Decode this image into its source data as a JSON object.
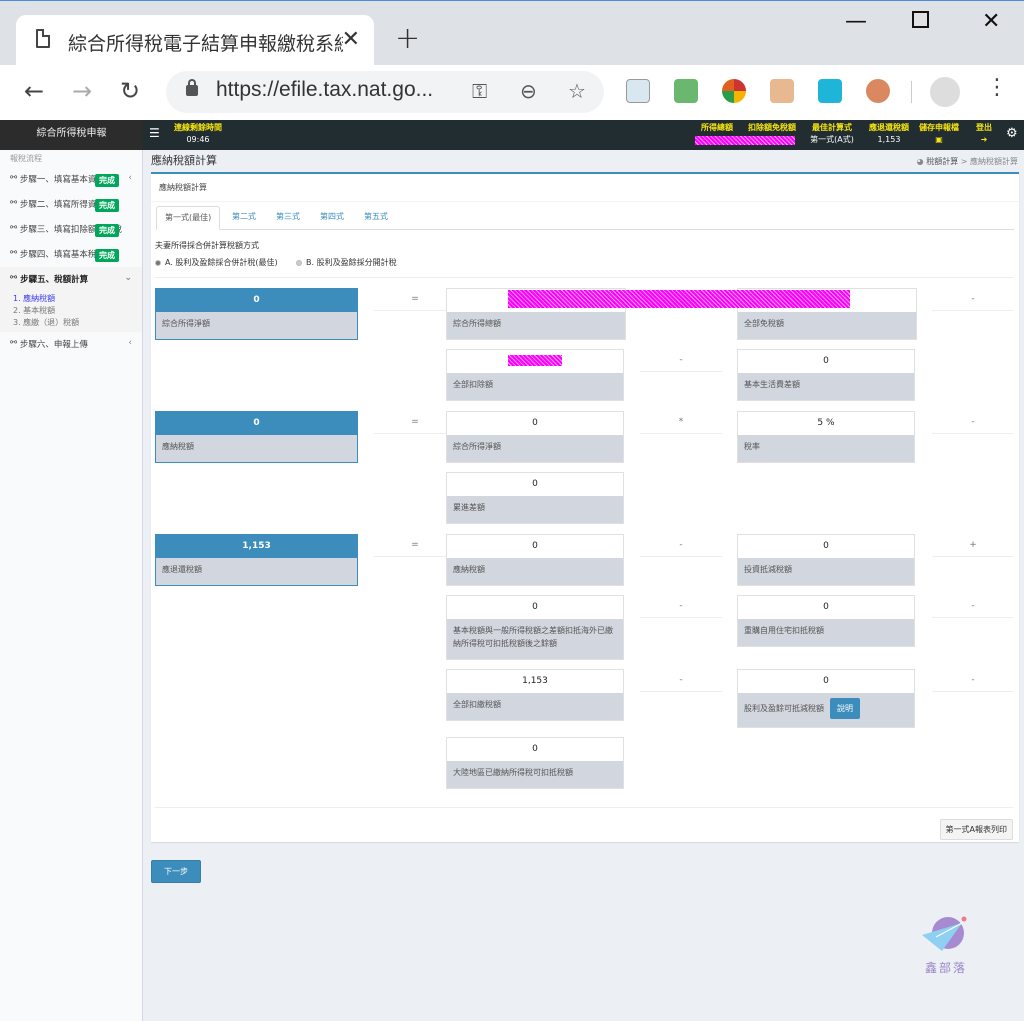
{
  "browser": {
    "tab_title": "綜合所得稅電子結算申報繳稅系統",
    "url": "https://efile.tax.nat.go...",
    "extensions": [
      "notes-ext",
      "email-ext",
      "lock-ext",
      "box-ext",
      "share-ext",
      "glasses-ext"
    ]
  },
  "header": {
    "brand": "綜合所得稅申報",
    "session_label": "連線剩餘時間",
    "session_time": "09:46",
    "total_income_label": "所得總額",
    "deduction_label": "扣除額免稅額",
    "best_formula_label": "最佳計算式",
    "best_formula_value": "第一式(A式)",
    "refund_label": "應退還稅額",
    "refund_value": "1,153",
    "save_label": "儲存申報檔",
    "logout_label": "登出"
  },
  "sidebar": {
    "heading": "報稅流程",
    "steps": [
      {
        "label": "步驟一、填寫基本資料",
        "badge": "完成"
      },
      {
        "label": "步驟二、填寫所得資料",
        "badge": "完成"
      },
      {
        "label": "步驟三、填寫扣除額及抵稅",
        "badge": "完成"
      },
      {
        "label": "步驟四、填寫基本稅額",
        "badge": "完成"
      },
      {
        "label": "步驟五、稅額計算",
        "badge": ""
      },
      {
        "label": "步驟六、申報上傳",
        "badge": ""
      }
    ],
    "sub_items": [
      "1. 應納稅額",
      "2. 基本稅額",
      "3. 應繳（退）稅額"
    ]
  },
  "page": {
    "title": "應納稅額計算",
    "breadcrumb": [
      "稅額計算",
      "應納稅額計算"
    ],
    "box_title": "應納稅額計算",
    "tabs": [
      "第一式(最佳)",
      "第二式",
      "第三式",
      "第四式",
      "第五式"
    ],
    "question": "夫妻所得採合併計算稅額方式",
    "option_a": "A. 股利及盈餘採合併計稅(最佳)",
    "option_b": "B. 股利及盈餘採分開計稅",
    "selected_option": "A"
  },
  "calc": {
    "net_income": {
      "label": "綜合所得淨額",
      "value": "0"
    },
    "gross_income": {
      "label": "綜合所得總額",
      "value": ""
    },
    "exemption": {
      "label": "全部免稅額",
      "value": ""
    },
    "deduction": {
      "label": "全部扣除額",
      "value": ""
    },
    "basic_living": {
      "label": "基本生活費差額",
      "value": "0"
    },
    "tax_payable": {
      "label": "應納稅額",
      "value": "0"
    },
    "net_income2": {
      "label": "綜合所得淨額",
      "value": "0"
    },
    "rate": {
      "label": "稅率",
      "value": "5 %"
    },
    "progressive": {
      "label": "累進差額",
      "value": "0"
    },
    "refund": {
      "label": "應退還稅額",
      "value": "1,153"
    },
    "tax_payable2": {
      "label": "應納稅額",
      "value": "0"
    },
    "invest_credit": {
      "label": "投資抵減稅額",
      "value": "0"
    },
    "amt_diff": {
      "label": "基本稅額與一般所得稅額之差額扣抵海外已繳納所得稅可扣抵稅額後之餘額",
      "value": "0"
    },
    "house_credit": {
      "label": "重購自用住宅扣抵稅額",
      "value": "0"
    },
    "withheld": {
      "label": "全部扣繳稅額",
      "value": "1,153"
    },
    "dividend_credit": {
      "label": "股利及盈餘可抵減稅額",
      "value": "0"
    },
    "mainland": {
      "label": "大陸地區已繳納所得稅可扣抵稅額",
      "value": "0"
    },
    "explain_label": "說明",
    "ops": {
      "eq": "=",
      "minus": "-",
      "times": "*",
      "plus": "+"
    }
  },
  "actions": {
    "print_label": "第一式A報表列印",
    "next_label": "下一步"
  },
  "watermark": "鑫部落"
}
